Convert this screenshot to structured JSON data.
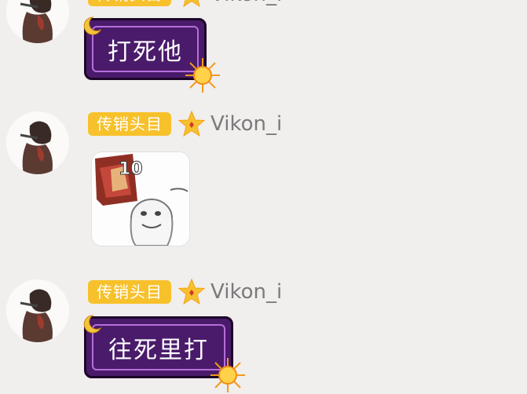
{
  "messages": [
    {
      "badge": "传销头目",
      "username": "Vikon_i",
      "text": "打死他"
    },
    {
      "badge": "传销头目",
      "username": "Vikon_i",
      "image": "meme-sticker",
      "sticker_text": "10"
    },
    {
      "badge": "传销头目",
      "username": "Vikon_i",
      "text": "往死里打"
    }
  ],
  "colors": {
    "background": "#f1eeee",
    "badge": "#f7c12b",
    "bubble": "#4a1b6a",
    "bubble_border": "#b56fdd",
    "username": "#7a7a7a"
  },
  "icons": {
    "level": "star-icon",
    "bubble_deco_left": "moon-icon",
    "bubble_deco_right": "sun-icon"
  }
}
